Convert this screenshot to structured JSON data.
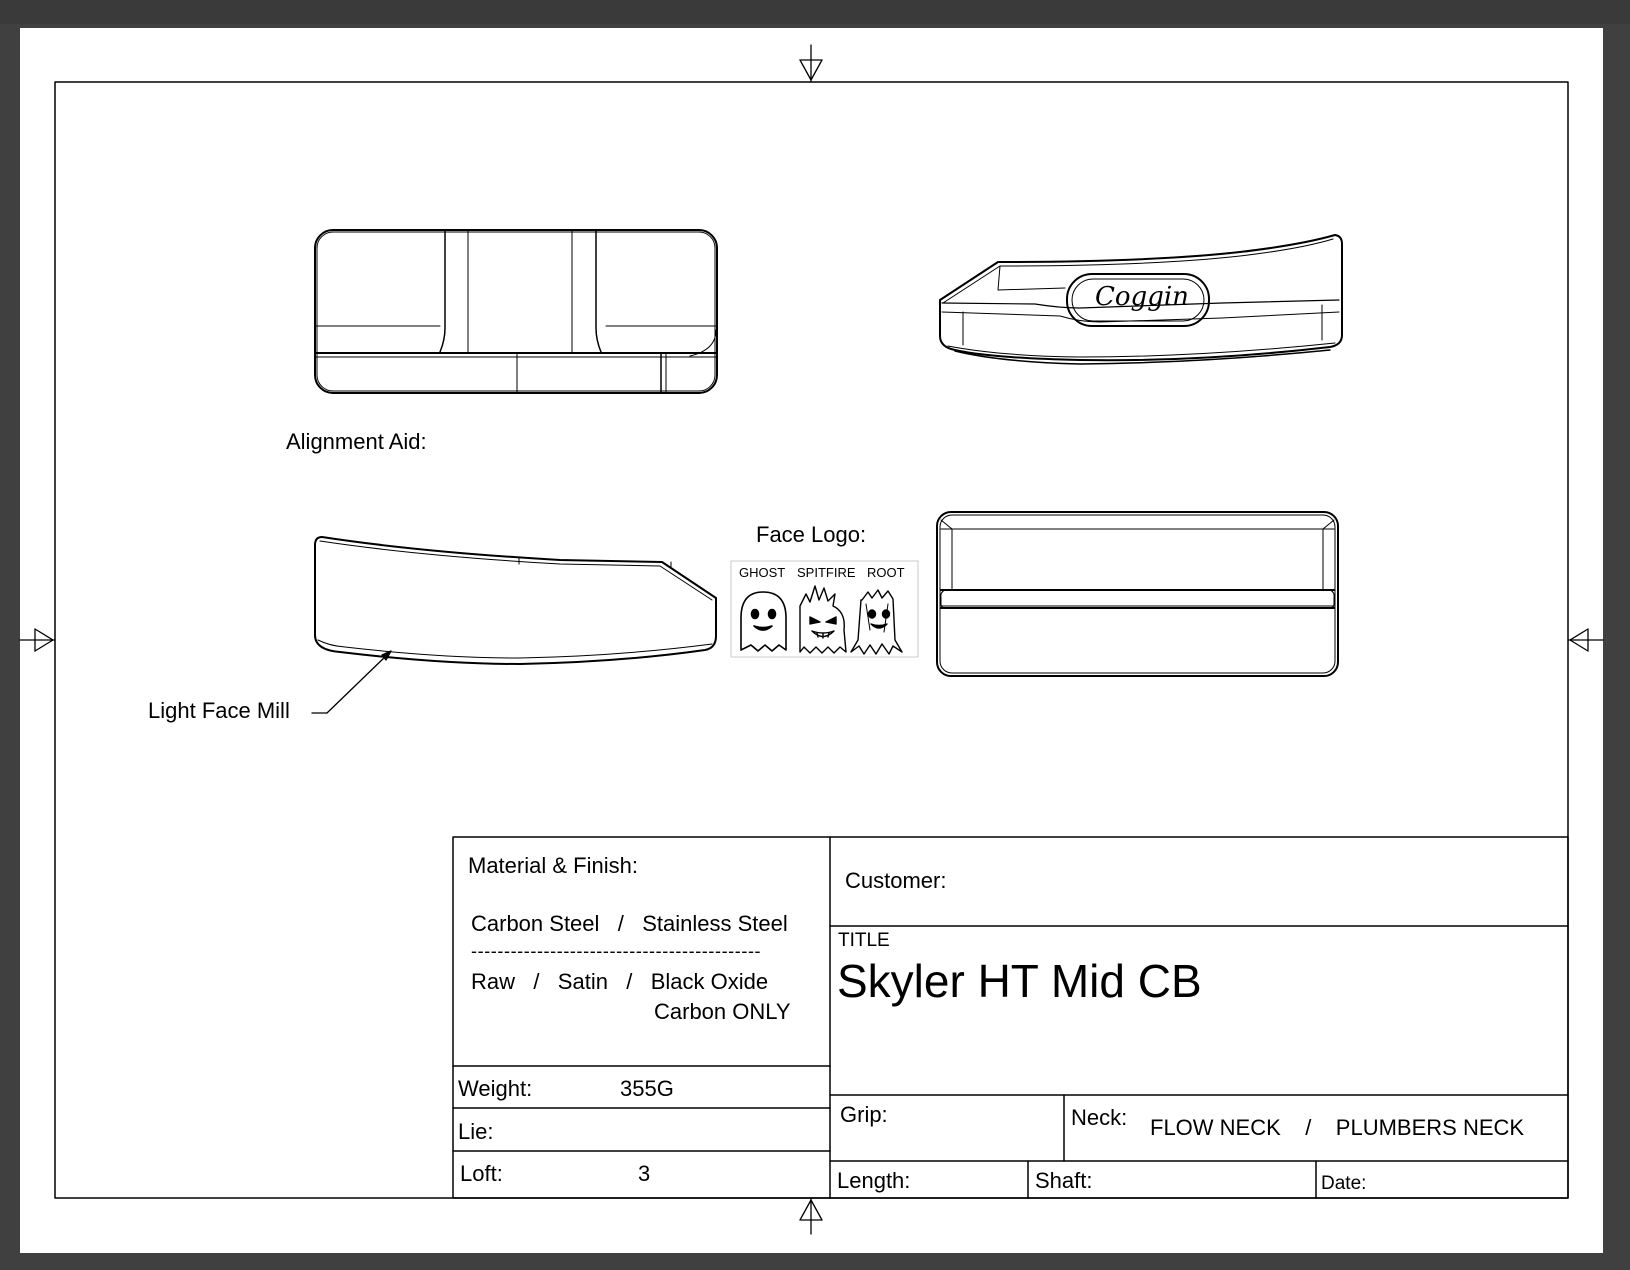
{
  "labels": {
    "alignment_aid": "Alignment Aid:",
    "face_logo": "Face Logo:",
    "light_face_mill": "Light Face Mill",
    "logo_text": "Coggin",
    "logos": [
      "GHOST",
      "SPITFIRE",
      "ROOT"
    ]
  },
  "title_block": {
    "material_label": "Material & Finish:",
    "material_options": "Carbon Steel   /   Stainless Steel",
    "dashes": "--------------------------------------------",
    "finish_options": "Raw   /   Satin   /   Black Oxide",
    "finish_note": "Carbon ONLY",
    "weight_label": "Weight:",
    "weight_value": "355G",
    "lie_label": "Lie:",
    "loft_label": "Loft:",
    "loft_value": "3",
    "customer_label": "Customer:",
    "title_caption": "TITLE",
    "title": "Skyler HT Mid CB",
    "grip_label": "Grip:",
    "neck_label": "Neck:",
    "neck_options": "FLOW NECK    /    PLUMBERS NECK",
    "length_label": "Length:",
    "shaft_label": "Shaft:",
    "date_label": "Date:"
  }
}
